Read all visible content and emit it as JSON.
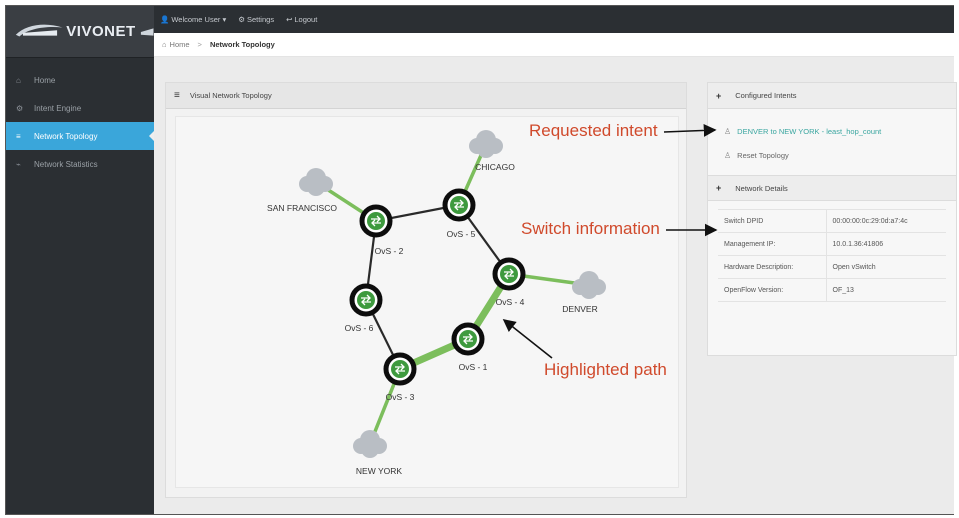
{
  "brand": {
    "name": "VIVONET"
  },
  "topbar": {
    "items": [
      {
        "icon": "user-icon",
        "label": "Welcome User ▾"
      },
      {
        "icon": "gear-icon",
        "label": "Settings"
      },
      {
        "icon": "logout-icon",
        "label": "Logout"
      }
    ]
  },
  "sidebar": {
    "items": [
      {
        "label": "Home",
        "icon": "home-icon",
        "active": false
      },
      {
        "label": "Intent Engine",
        "icon": "gear-icon",
        "active": false
      },
      {
        "label": "Network Topology",
        "icon": "topology-icon",
        "active": true
      },
      {
        "label": "Network Statistics",
        "icon": "chart-icon",
        "active": false
      }
    ]
  },
  "breadcrumb": {
    "home": "Home",
    "separator": ">",
    "current": "Network Topology"
  },
  "topology": {
    "title": "Visual Network Topology",
    "nodes": [
      {
        "id": "ovs2",
        "label": "OvS - 2"
      },
      {
        "id": "ovs5",
        "label": "OvS - 5"
      },
      {
        "id": "ovs4",
        "label": "OvS - 4"
      },
      {
        "id": "ovs6",
        "label": "OvS - 6"
      },
      {
        "id": "ovs1",
        "label": "OvS - 1"
      },
      {
        "id": "ovs3",
        "label": "OvS - 3"
      }
    ],
    "clouds": [
      {
        "id": "sf",
        "label": "SAN FRANCISCO"
      },
      {
        "id": "chi",
        "label": "CHICAGO"
      },
      {
        "id": "den",
        "label": "DENVER"
      },
      {
        "id": "ny",
        "label": "NEW YORK"
      }
    ],
    "links": [
      [
        "sf",
        "ovs2"
      ],
      [
        "chi",
        "ovs5"
      ],
      [
        "den",
        "ovs4"
      ],
      [
        "ny",
        "ovs3"
      ],
      [
        "ovs2",
        "ovs5"
      ],
      [
        "ovs5",
        "ovs4"
      ],
      [
        "ovs2",
        "ovs6"
      ],
      [
        "ovs6",
        "ovs3"
      ],
      [
        "ovs4",
        "ovs1"
      ],
      [
        "ovs1",
        "ovs3"
      ]
    ],
    "highlighted_links": [
      [
        "ovs4",
        "ovs1"
      ],
      [
        "ovs1",
        "ovs3"
      ]
    ],
    "colors": {
      "highlight": "#7cbe5c",
      "link": "#2a2a2a",
      "node_fill": "#3e9a3e"
    }
  },
  "intents_panel": {
    "title": "Configured Intents",
    "intent": "DENVER to NEW YORK - least_hop_count",
    "reset_label": "Reset Topology"
  },
  "details_panel": {
    "title": "Network Details",
    "rows": [
      {
        "key": "Switch DPID",
        "value": "00:00:00:0c:29:0d:a7:4c"
      },
      {
        "key": "Management IP:",
        "value": "10.0.1.36:41806"
      },
      {
        "key": "Hardware Description:",
        "value": "Open vSwitch"
      },
      {
        "key": "OpenFlow Version:",
        "value": "OF_13"
      }
    ]
  },
  "annotations": {
    "requested_intent": "Requested intent",
    "switch_information": "Switch information",
    "highlighted_path": "Highlighted path",
    "color": "#d04a2c"
  }
}
